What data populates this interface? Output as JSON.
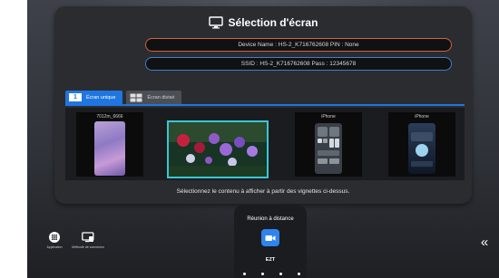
{
  "dialog": {
    "title": "Sélection d'écran",
    "device_line": "Device Name : HS-2_K716762608   PIN : None",
    "ssid_line": "SSID : HS-2_K716762608   Pass : 12345678",
    "hint": "Sélectionnez le contenu à afficher à partir des vignettes ci-dessus."
  },
  "tabs": [
    {
      "badge": "1",
      "label": "Écran unique",
      "selected": true
    },
    {
      "badge": "",
      "label": "Écran divisé",
      "selected": false
    }
  ],
  "thumbnails": [
    {
      "caption": "7012m_6666",
      "selected": false
    },
    {
      "caption": "",
      "selected": true
    },
    {
      "caption": "iPhone",
      "selected": false
    },
    {
      "caption": "iPhone",
      "selected": false
    }
  ],
  "bottom": {
    "meeting_label": "Réunion à distance",
    "ezt_label": "EZT",
    "app_label": "Application",
    "conn_label": "Méthode de connexion",
    "collapse_glyph": "«"
  },
  "colors": {
    "accent": "#1f76e0",
    "device_border": "#d4623a",
    "ssid_border": "#3d7fd1",
    "thumb_selected": "#39c6d6"
  },
  "icons": [
    "monitor-icon",
    "split-screen-icon",
    "apps-grid-icon",
    "connection-icon",
    "ezt-icon",
    "collapse-icon"
  ]
}
